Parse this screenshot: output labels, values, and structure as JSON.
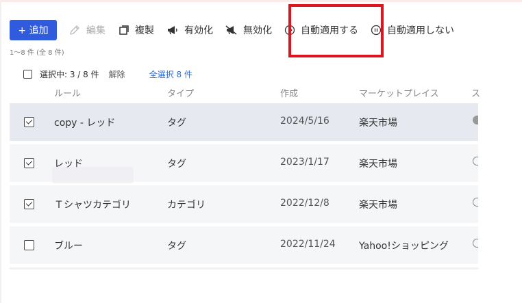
{
  "toolbar": {
    "add_label": "+ 追加",
    "edit_label": "編集",
    "duplicate_label": "複製",
    "enable_label": "有効化",
    "disable_label": "無効化",
    "auto_apply_label": "自動適用する",
    "no_auto_apply_label": "自動適用しない"
  },
  "count_text": "1～8 件 (全 8 件)",
  "selection": {
    "selected_text": "選択中: 3 / 8 件",
    "clear_label": "解除",
    "select_all_label": "全選択 8 件"
  },
  "table": {
    "headers": [
      "ルール",
      "タイプ",
      "作成",
      "マーケットプレイス",
      "ス"
    ],
    "rows": [
      {
        "rule": "copy - レッド",
        "type": "タグ",
        "created": "2024/5/16",
        "marketplace": "楽天市場",
        "checked": true,
        "active": true
      },
      {
        "rule": "レッド",
        "type": "タグ",
        "created": "2023/1/17",
        "marketplace": "楽天市場",
        "checked": true,
        "active": false
      },
      {
        "rule": "Ｔシャツカテゴリ",
        "type": "カテゴリ",
        "created": "2022/12/8",
        "marketplace": "楽天市場",
        "checked": true,
        "active": false
      },
      {
        "rule": "ブルー",
        "type": "タグ",
        "created": "2022/11/24",
        "marketplace": "Yahoo!ショッピング",
        "checked": false,
        "active": false
      }
    ]
  },
  "colors": {
    "primary": "#2f5bdc",
    "highlight": "#e0141e",
    "link": "#2f6fd6"
  }
}
